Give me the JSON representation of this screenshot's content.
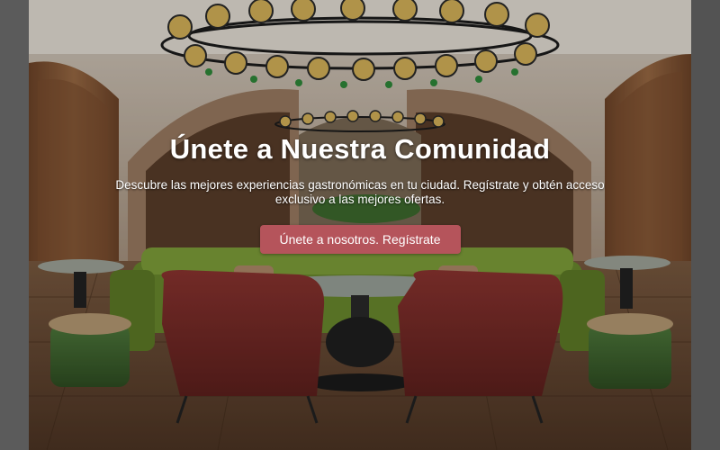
{
  "hero": {
    "title": "Únete a Nuestra Comunidad",
    "subtitle": "Descubre las mejores experiencias gastronómicas en tu ciudad. Regístrate y obtén acceso exclusivo a las mejores ofertas.",
    "cta_label": "Únete a nosotros. Regístrate"
  },
  "colors": {
    "accent": "#b5545b",
    "chair_red": "#7a2a26",
    "sofa_green": "#6b8a2e",
    "wood": "#8a5a3a"
  }
}
